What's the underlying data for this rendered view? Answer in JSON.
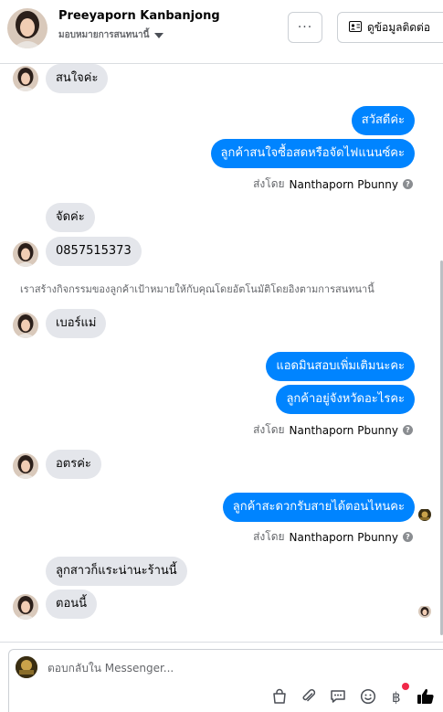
{
  "header": {
    "contact_name": "Preeyaporn Kanbanjong",
    "assign_label": "มอบหมายการสนทนานี้",
    "more_label": "···",
    "info_label": "ดูข้อมูลติดต่อ"
  },
  "messages": {
    "m1": "สนใจค่ะ",
    "m2": "สวัสดีค่ะ",
    "m3": "ลูกค้าสนใจซื้อสดหรือจัดไฟแนนซ์คะ",
    "sent1_prefix": "ส่งโดย",
    "sent1_name": "Nanthaporn Pbunny",
    "m4": "จัดค่ะ",
    "m5": "0857515373",
    "system_note": "เราสร้างกิจกรรมของลูกค้าเป้าหมายให้กับคุณโดยอัตโนมัติโดยอิงตามการสนทนานี้",
    "m6": "เบอร์แม่",
    "m7": "แอดมินสอบเพิ่มเติมนะคะ",
    "m8": "ลูกค้าอยู่จังหวัดอะไรคะ",
    "sent2_prefix": "ส่งโดย",
    "sent2_name": "Nanthaporn Pbunny",
    "m9": "อตรค่ะ",
    "m10": "ลูกค้าสะดวกรับสายได้ตอนไหนคะ",
    "sent3_prefix": "ส่งโดย",
    "sent3_name": "Nanthaporn Pbunny",
    "m11": "ลูกสาวก็แระน่านะร้านนี้",
    "m12": "ตอนนี้"
  },
  "composer": {
    "placeholder": "ตอบกลับใน Messenger..."
  },
  "icons": [
    "menu-dots-icon",
    "contact-card-icon",
    "chevron-down-icon",
    "info-icon",
    "shopping-bag-icon",
    "paperclip-icon",
    "saved-replies-icon",
    "emoji-icon",
    "baht-icon",
    "thumbs-up-icon"
  ],
  "colors": {
    "outgoing_bubble": "#0084ff",
    "incoming_bubble": "#e4e6eb",
    "notification": "#f02849"
  }
}
